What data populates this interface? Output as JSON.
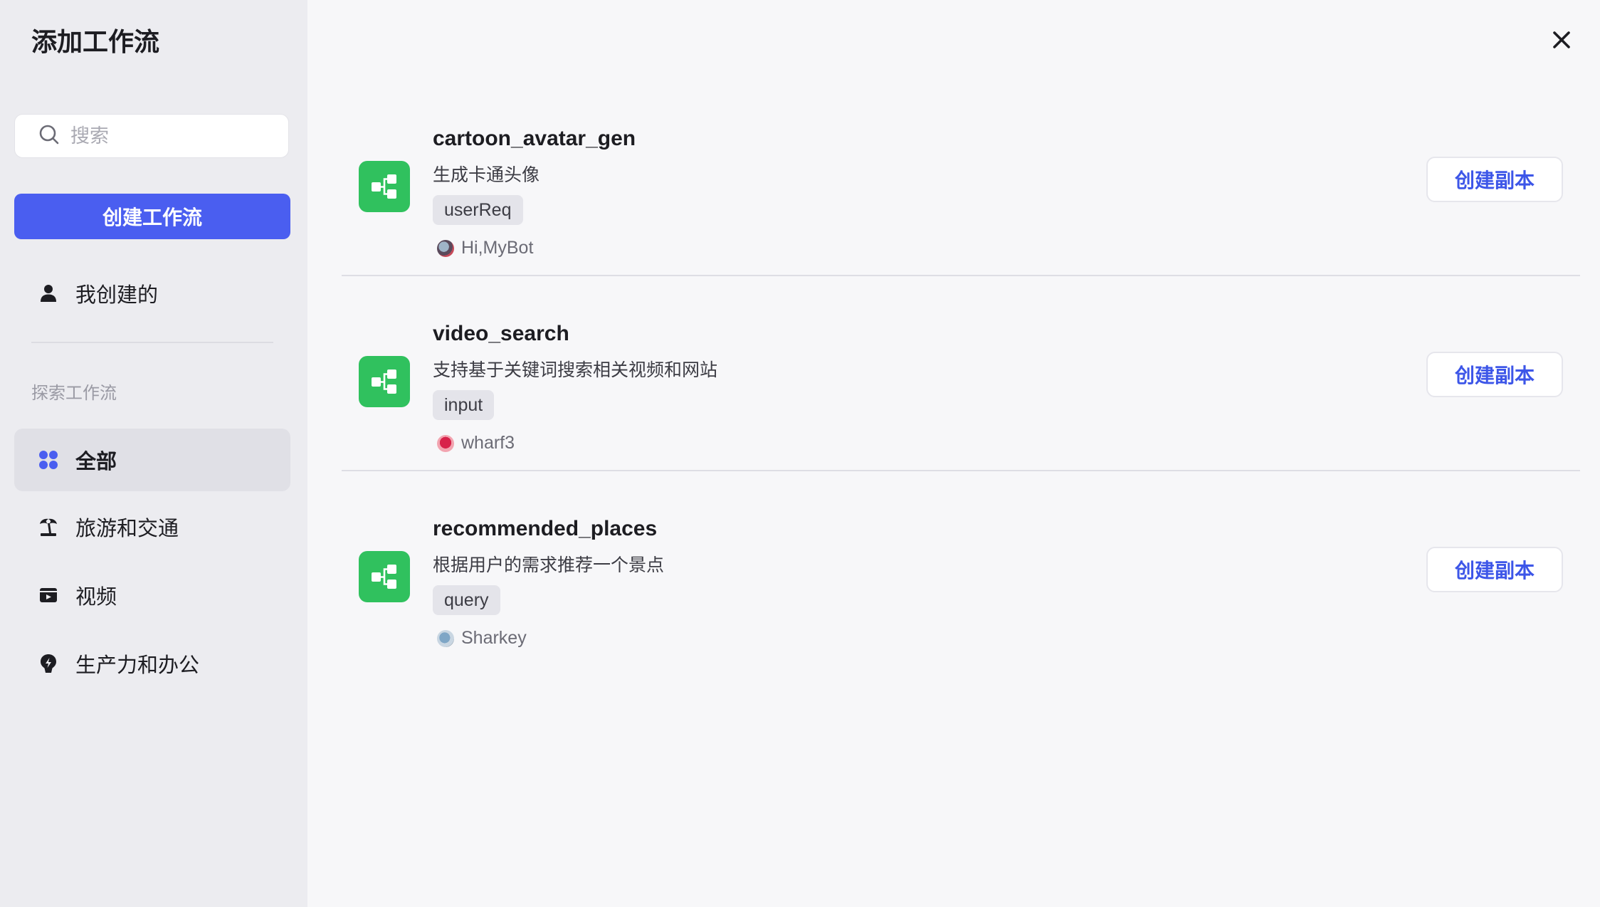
{
  "dialog": {
    "title": "添加工作流",
    "close_icon": "close-icon"
  },
  "sidebar": {
    "search": {
      "placeholder": "搜索",
      "value": ""
    },
    "create_button": "创建工作流",
    "my_created": {
      "label": "我创建的",
      "icon": "user-icon"
    },
    "section_label": "探索工作流",
    "categories": [
      {
        "label": "全部",
        "icon": "grid-icon",
        "active": true
      },
      {
        "label": "旅游和交通",
        "icon": "palm-tree-icon",
        "active": false
      },
      {
        "label": "视频",
        "icon": "video-icon",
        "active": false
      },
      {
        "label": "生产力和办公",
        "icon": "lightbulb-icon",
        "active": false
      }
    ]
  },
  "workflows": [
    {
      "name": "cartoon_avatar_gen",
      "description": "生成卡通头像",
      "tag": "userReq",
      "author": "Hi,MyBot",
      "action": "创建副本"
    },
    {
      "name": "video_search",
      "description": "支持基于关键词搜索相关视频和网站",
      "tag": "input",
      "author": "wharf3",
      "action": "创建副本"
    },
    {
      "name": "recommended_places",
      "description": "根据用户的需求推荐一个景点",
      "tag": "query",
      "author": "Sharkey",
      "action": "创建副本"
    }
  ],
  "colors": {
    "accent": "#4a5ef0",
    "workflow_icon_bg": "#30c15e",
    "sidebar_bg": "#ececf0",
    "main_bg": "#f7f7f9"
  }
}
